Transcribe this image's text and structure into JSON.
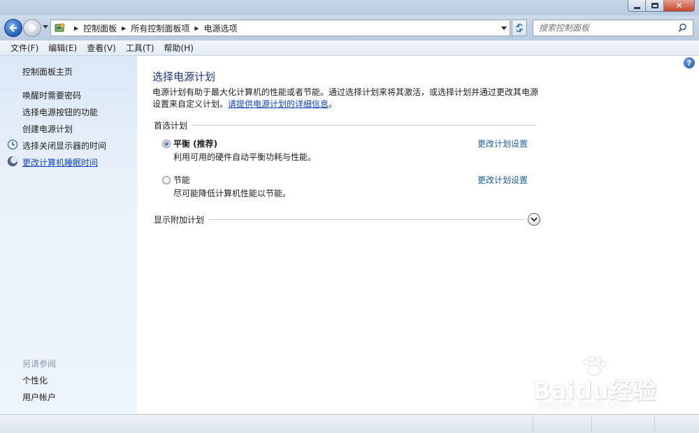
{
  "address": {
    "breadcrumbs": [
      "控制面板",
      "所有控制面板项",
      "电源选项"
    ],
    "search_placeholder": "搜索控制面板"
  },
  "menu": [
    "文件(F)",
    "编辑(E)",
    "查看(V)",
    "工具(T)",
    "帮助(H)"
  ],
  "sidebar": {
    "home": "控制面板主页",
    "links": [
      "唤醒时需要密码",
      "选择电源按钮的功能",
      "创建电源计划",
      "选择关闭显示器的时间",
      "更改计算机睡眠时间"
    ],
    "see_also_heading": "另请参阅",
    "see_also": [
      "个性化",
      "用户帐户"
    ]
  },
  "main": {
    "title": "选择电源计划",
    "description": "电源计划有助于最大化计算机的性能或者节能。通过选择计划来将其激活，或选择计划并通过更改其电源设置来自定义计划。",
    "description_link": "请提供电源计划的详细信息",
    "description_end": "。",
    "group_label": "首选计划",
    "plans": [
      {
        "name": "平衡 (推荐)",
        "desc": "利用可用的硬件自动平衡功耗与性能。",
        "link": "更改计划设置",
        "selected": true
      },
      {
        "name": "节能",
        "desc": "尽可能降低计算机性能以节能。",
        "link": "更改计划设置",
        "selected": false
      }
    ],
    "extra_plans_label": "显示附加计划",
    "help_label": "?"
  },
  "watermark": {
    "brand": "Baidu经验",
    "url": "jingyan.baidu.com"
  },
  "colors": {
    "link": "#1144cc",
    "title": "#1e3287",
    "sidebar_bg": "#e4eefa"
  }
}
